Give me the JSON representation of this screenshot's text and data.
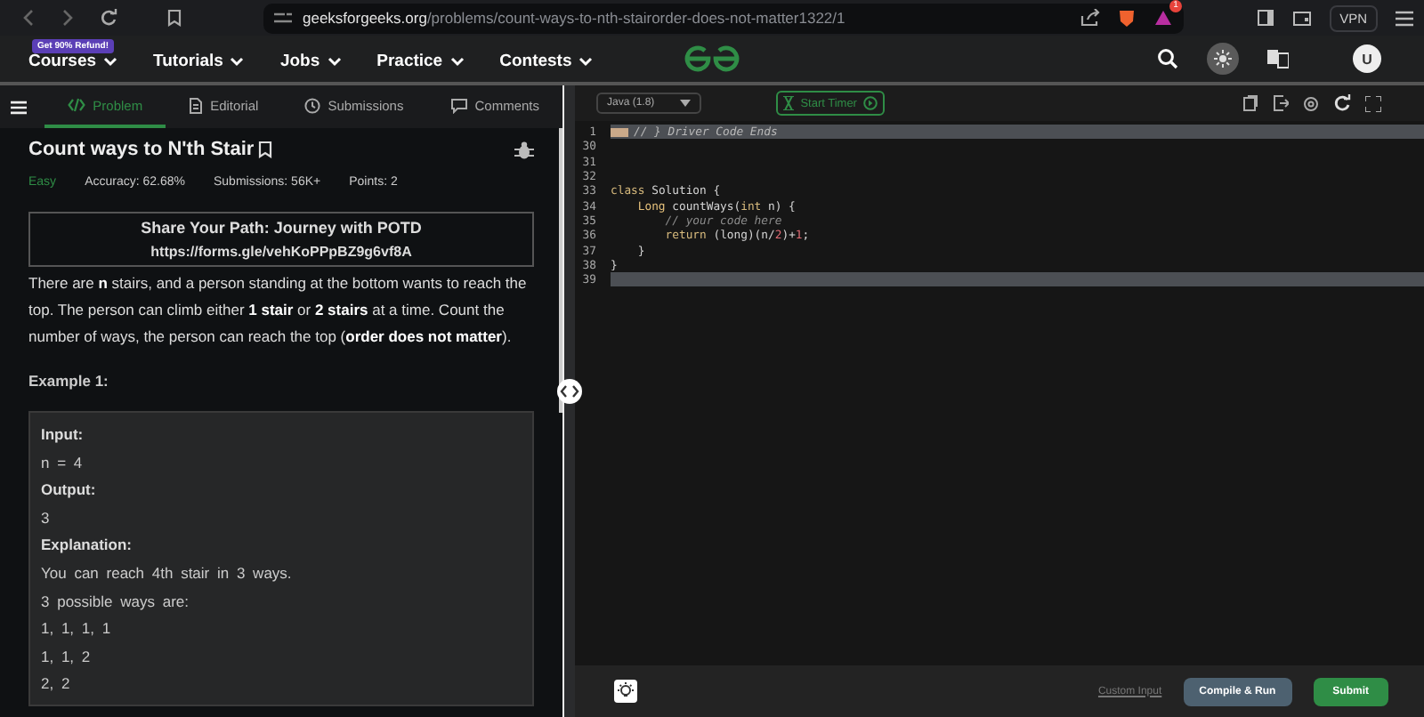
{
  "browser": {
    "url_domain": "geeksforgeeks.org",
    "url_path": "/problems/count-ways-to-nth-stairorder-does-not-matter1322/1",
    "vpn": "VPN",
    "notification_count": "1"
  },
  "nav": {
    "promo": "Get 90% Refund!",
    "items": [
      "Courses",
      "Tutorials",
      "Jobs",
      "Practice",
      "Contests"
    ],
    "avatar": "U"
  },
  "tabs": [
    {
      "label": "Problem",
      "selected": true
    },
    {
      "label": "Editorial",
      "selected": false
    },
    {
      "label": "Submissions",
      "selected": false
    },
    {
      "label": "Comments",
      "selected": false
    }
  ],
  "problem": {
    "title": "Count ways to N'th Stair",
    "difficulty": "Easy",
    "accuracy": "Accuracy: 62.68%",
    "submissions": "Submissions: 56K+",
    "points": "Points: 2",
    "notice_title": "Share Your Path: Journey with POTD",
    "notice_link": "https://forms.gle/vehKoPPpBZ9g6vf8A",
    "description": "There are **n** stairs, and a person standing at the bottom wants to reach the top. The person can climb either **1 stair** or **2 stairs** at a time. Count the number of ways, the person can reach the top (**order does not matter**).",
    "example_title": "Example 1:",
    "example_lines": [
      {
        "kind": "label",
        "text": "Input:"
      },
      {
        "kind": "value",
        "text": "n = 4"
      },
      {
        "kind": "label",
        "text": "Output:"
      },
      {
        "kind": "value",
        "text": "3"
      },
      {
        "kind": "label",
        "text": "Explanation:"
      },
      {
        "kind": "value",
        "text": "You can reach 4th stair in 3 ways."
      },
      {
        "kind": "value",
        "text": "3 possible ways are:"
      },
      {
        "kind": "value",
        "text": "1, 1, 1, 1"
      },
      {
        "kind": "value",
        "text": "1, 1, 2"
      },
      {
        "kind": "value",
        "text": "2, 2"
      }
    ]
  },
  "editor": {
    "language": "Java (1.8)",
    "timer": "Start Timer",
    "lines": [
      {
        "number": "1",
        "highlighted": true,
        "folded": true,
        "tokens": [
          {
            "kind": "comment",
            "text": "// } Driver Code Ends"
          }
        ]
      },
      {
        "number": "30",
        "highlighted": false,
        "folded": false
      },
      {
        "number": "31",
        "highlighted": false,
        "folded": false
      },
      {
        "number": "32",
        "highlighted": false,
        "folded": false
      },
      {
        "number": "33",
        "highlighted": false,
        "folded": false,
        "tokens": [
          {
            "kind": "keyword",
            "text": "class"
          },
          {
            "kind": "plain",
            "text": " Solution {"
          }
        ]
      },
      {
        "number": "34",
        "highlighted": false,
        "folded": false,
        "tokens": [
          {
            "kind": "type",
            "text": "    Long"
          },
          {
            "kind": "plain",
            "text": " countWays("
          },
          {
            "kind": "keyword",
            "text": "int"
          },
          {
            "kind": "plain",
            "text": " n) {"
          }
        ]
      },
      {
        "number": "35",
        "highlighted": false,
        "folded": false,
        "tokens": [
          {
            "kind": "comment",
            "text": "        // your code here"
          }
        ]
      },
      {
        "number": "36",
        "highlighted": false,
        "folded": false,
        "tokens": [
          {
            "kind": "keyword",
            "text": "        return"
          },
          {
            "kind": "plain",
            "text": " (long)(n/"
          },
          {
            "kind": "number",
            "text": "2"
          },
          {
            "kind": "plain",
            "text": ")+"
          },
          {
            "kind": "number",
            "text": "1"
          },
          {
            "kind": "plain",
            "text": ";"
          }
        ]
      },
      {
        "number": "37",
        "highlighted": false,
        "folded": false,
        "tokens": [
          {
            "kind": "plain",
            "text": "    }"
          }
        ]
      },
      {
        "number": "38",
        "highlighted": false,
        "folded": false,
        "tokens": [
          {
            "kind": "plain",
            "text": "}"
          }
        ]
      },
      {
        "number": "39",
        "highlighted": true,
        "folded": false
      }
    ],
    "custom_input": "Custom Input",
    "compile": "Compile & Run",
    "submit": "Submit"
  }
}
